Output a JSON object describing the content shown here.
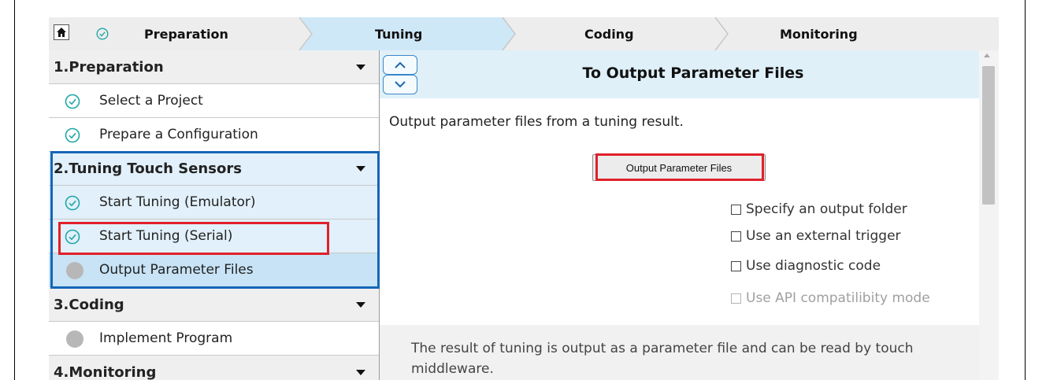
{
  "steps": [
    "Preparation",
    "Tuning",
    "Coding",
    "Monitoring"
  ],
  "nav": {
    "sections": [
      {
        "title": "1.Preparation",
        "items": [
          {
            "label": "Select a Project",
            "status": "done"
          },
          {
            "label": "Prepare a Configuration",
            "status": "done"
          }
        ]
      },
      {
        "title": "2.Tuning Touch Sensors",
        "items": [
          {
            "label": "Start Tuning (Emulator)",
            "status": "done"
          },
          {
            "label": "Start Tuning (Serial)",
            "status": "done"
          },
          {
            "label": "Output Parameter Files",
            "status": "pending"
          }
        ]
      },
      {
        "title": "3.Coding",
        "items": [
          {
            "label": "Implement Program",
            "status": "pending"
          }
        ]
      },
      {
        "title": "4.Monitoring",
        "items": []
      }
    ]
  },
  "main": {
    "title": "To Output Parameter Files",
    "description": "Output parameter files from a tuning result.",
    "button_label": "Output Parameter Files",
    "options": [
      {
        "label": "Specify an output folder",
        "checked": false,
        "enabled": true
      },
      {
        "label": "Use an external trigger",
        "checked": false,
        "enabled": true
      },
      {
        "label": "Use diagnostic code",
        "checked": false,
        "enabled": true
      },
      {
        "label": "Use API compatilibity mode",
        "checked": false,
        "enabled": false
      }
    ],
    "note": "The result of tuning is output as a parameter file and can be read by touch middleware."
  },
  "colors": {
    "active_step": "#cfe8f7",
    "highlight_outline": "#1565b6",
    "annotation_red": "#e0202a",
    "check_teal": "#21a7a7"
  },
  "icons": [
    "home-icon",
    "check-circle-icon",
    "caret-down-icon",
    "chevron-up-icon",
    "chevron-down-icon",
    "status-dot-icon"
  ]
}
